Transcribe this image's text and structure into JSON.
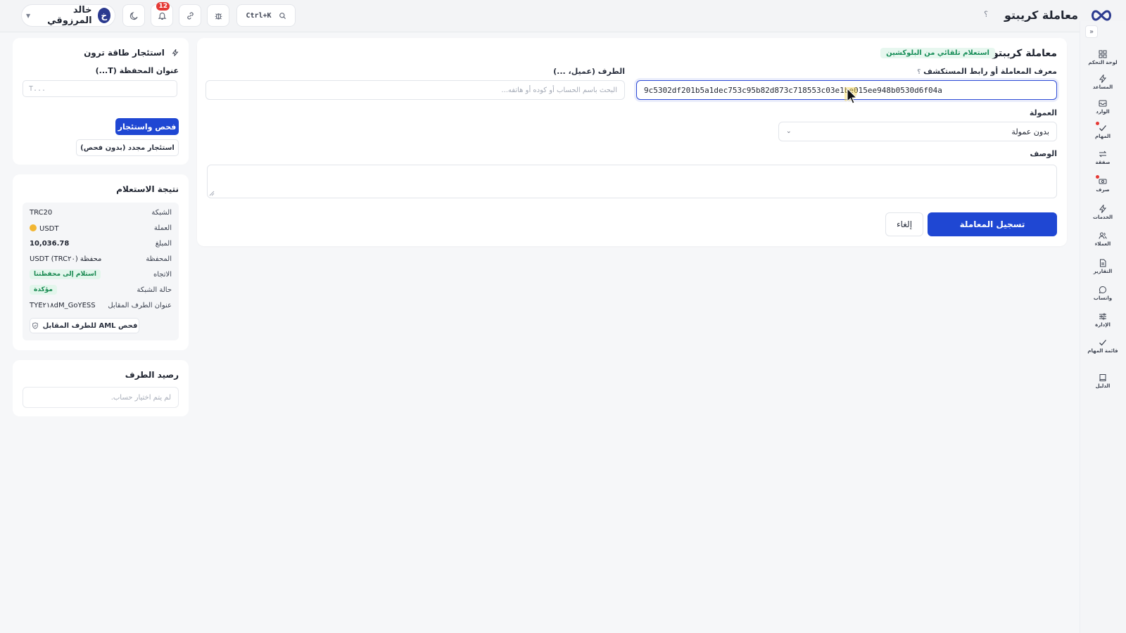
{
  "colors": {
    "accent": "#1f47d3",
    "success": "#16884f",
    "danger": "#e53935"
  },
  "header": {
    "page_title": "معاملة كريبتو",
    "help_label": "؟",
    "user_name": "خالد المرزوقي",
    "user_initial": "خ",
    "notifications_count": "12",
    "search_shortcut": "Ctrl+K"
  },
  "sidebar": {
    "items": [
      {
        "label": "لوحة التحكم",
        "icon": "dashboard-icon"
      },
      {
        "label": "المساعد",
        "icon": "bolt-icon"
      },
      {
        "label": "الوارد",
        "icon": "inbox-icon"
      },
      {
        "label": "المهام",
        "icon": "check-icon"
      },
      {
        "label": "صفقة",
        "icon": "exchange-icon"
      },
      {
        "label": "صرف",
        "icon": "cash-icon"
      },
      {
        "label": "الخدمات",
        "icon": "bolt-icon"
      },
      {
        "label": "العملاء",
        "icon": "users-icon"
      },
      {
        "label": "التقارير",
        "icon": "report-icon"
      },
      {
        "label": "واتساب",
        "icon": "chat-icon"
      },
      {
        "label": "الإدارة",
        "icon": "sliders-icon"
      },
      {
        "label": "قائمة المهام",
        "icon": "check-icon"
      },
      {
        "label": "الدليل",
        "icon": "book-icon"
      }
    ]
  },
  "form": {
    "title": "معاملة كريبتو",
    "badge": "استعلام تلقائي من البلوكشين",
    "txid_label": "معرف المعاملة أو رابط المستكشف",
    "txid_help": "؟",
    "txid_value": "9c5302df201b5a1dec753c95b82d873c718553c03e1be015ee948b0530d6f04a",
    "party_label": "الطرف (عميل، ...)",
    "party_placeholder": "البحث باسم الحساب أو كوده أو هاتفه...",
    "commission_label": "العمولة",
    "commission_value": "بدون عمولة",
    "description_label": "الوصف",
    "submit_label": "تسجيل المعاملة",
    "cancel_label": "إلغاء"
  },
  "tron_panel": {
    "title": "استئجار طاقة ترون",
    "wallet_label": "عنوان المحفظة (T...)",
    "wallet_placeholder": "T...",
    "check_rent_label": "فحص واستئجار",
    "rent_again_label": "استئجار مجدد (بدون فحص)"
  },
  "result_panel": {
    "title": "نتيجة الاستعلام",
    "rows": [
      {
        "label": "الشبكة",
        "value": "TRC20"
      },
      {
        "label": "العملة",
        "value": "USDT"
      },
      {
        "label": "المبلغ",
        "value": "10,036.78"
      },
      {
        "label": "المحفظة",
        "value": "محفظة (USDT (TRC۲۰"
      },
      {
        "label": "الاتجاه",
        "value": "استلام إلى محفظتنا"
      },
      {
        "label": "حالة الشبكة",
        "value": "مؤكدة"
      },
      {
        "label": "عنوان الطرف المقابل",
        "value": "TYE۲۱۸dM_GoYESS"
      }
    ],
    "aml_label": "فحص AML للطرف المقابل"
  },
  "balance_panel": {
    "title": "رصيد الطرف",
    "empty_text": "لم يتم اختيار حساب."
  }
}
